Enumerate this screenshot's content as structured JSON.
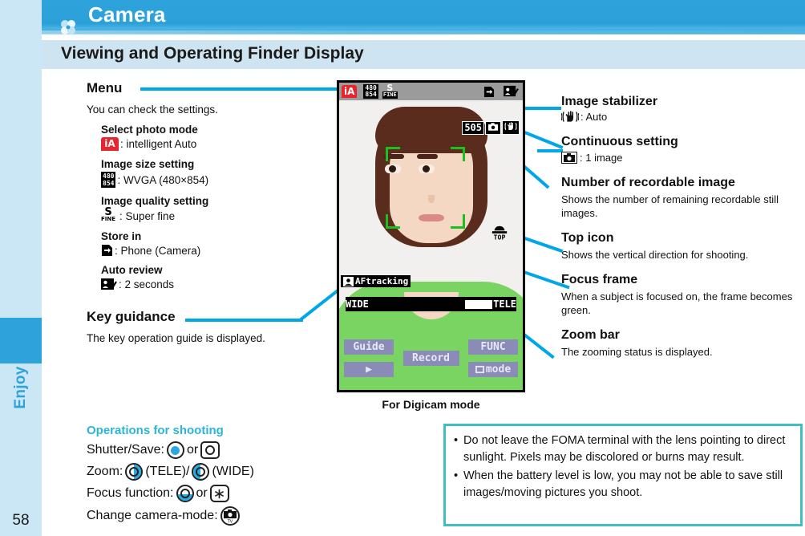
{
  "sidebar": {
    "tab_label": "Enjoy",
    "page_number": "58"
  },
  "header": {
    "title": "Camera",
    "clover_icon": "clover-icon"
  },
  "section": {
    "title": "Viewing and Operating Finder Display"
  },
  "left_annotations": {
    "menu": {
      "title": "Menu",
      "description": "You can check the settings.",
      "items": [
        {
          "heading": "Select photo mode",
          "icon": "ia-icon",
          "value": ": intelligent Auto"
        },
        {
          "heading": "Image size setting",
          "icon": "image-size-icon",
          "value": ": WVGA (480×854)"
        },
        {
          "heading": "Image quality setting",
          "icon": "super-fine-icon",
          "value": ": Super fine"
        },
        {
          "heading": "Store in",
          "icon": "store-in-icon",
          "value": ": Phone (Camera)"
        },
        {
          "heading": "Auto review",
          "icon": "auto-review-icon",
          "value": ": 2 seconds"
        }
      ]
    },
    "key_guidance": {
      "title": "Key guidance",
      "description": "The key operation guide is displayed."
    }
  },
  "right_annotations": [
    {
      "title": "Image stabilizer",
      "icon": "stabilizer-icon",
      "value": ": Auto",
      "body": ""
    },
    {
      "title": "Continuous setting",
      "icon": "camera-icon",
      "value": ": 1 image",
      "body": ""
    },
    {
      "title": "Number of recordable image",
      "icon": "",
      "value": "",
      "body": "Shows the number of remaining recordable still images."
    },
    {
      "title": "Top icon",
      "icon": "",
      "value": "",
      "body": "Shows the vertical direction for shooting."
    },
    {
      "title": "Focus frame",
      "icon": "",
      "value": "",
      "body": "When a subject is focused on, the frame becomes green."
    },
    {
      "title": "Zoom bar",
      "icon": "",
      "value": "",
      "body": "The zooming status is displayed."
    }
  ],
  "phone_screen": {
    "caption": "For Digicam mode",
    "status_bar": {
      "photo_mode": "iA",
      "size_top": "480",
      "size_bottom": "854",
      "quality_main": "S",
      "quality_sub": "FINE",
      "store_icon": "store-in-icon",
      "review_icon": "auto-review-icon"
    },
    "recordable_count": "505",
    "continuous_icon": "camera-icon",
    "stabilizer_icon": "stabilizer-icon",
    "top_icon_label": "TOP",
    "af_tracking_label": "AFtracking",
    "zoom_bar": {
      "wide_label": "WIDE",
      "tele_label": "TELE",
      "fill_percent": 78
    },
    "soft_keys": {
      "guide": "Guide",
      "play": "▶",
      "record": "Record",
      "func": "FUNC",
      "mode": "mode"
    }
  },
  "operations": {
    "title": "Operations for shooting",
    "rows": [
      {
        "label": "Shutter/Save:",
        "mid": "or",
        "suffix": ""
      },
      {
        "label": "Zoom:",
        "mid": "(TELE)/",
        "suffix": "(WIDE)"
      },
      {
        "label": "Focus function:",
        "mid": "or",
        "suffix": ""
      },
      {
        "label": "Change camera-mode:",
        "mid": "",
        "suffix": ""
      }
    ]
  },
  "note_box": {
    "items": [
      "Do not leave the FOMA terminal with the lens pointing to direct sunlight. Pixels may be discolored or burns may result.",
      "When the battery level is low, you may not be able to save still images/moving pictures you shoot."
    ],
    "bullet": "•"
  },
  "colors": {
    "header_blue": "#2ea3db",
    "section_blue": "#cee4f0",
    "sidebar_blue": "#cbe7f5",
    "connector_blue": "#00a7e8",
    "note_border": "#3fbfbf",
    "ops_title": "#2bb5d6",
    "focus_green": "#1dbf1d"
  }
}
